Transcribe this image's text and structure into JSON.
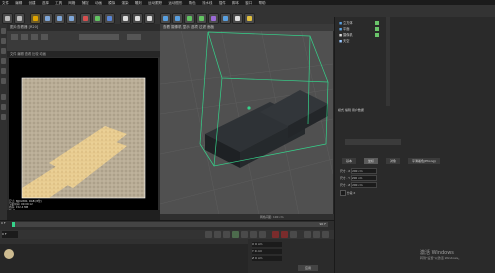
{
  "menubar": {
    "items": [
      "文件",
      "编辑",
      "创建",
      "选择",
      "工具",
      "网格",
      "捕捉",
      "动画",
      "模拟",
      "渲染",
      "雕刻",
      "运动跟踪",
      "运动图形",
      "角色",
      "流水线",
      "插件",
      "脚本",
      "窗口",
      "帮助"
    ]
  },
  "render_view": {
    "title": "图片查看器 [R20]",
    "menu": "文件  编辑  查看  比较  动画",
    "info_lines": [
      "尺寸: 800x800, RGB (8位)",
      "渲染时间: 00:00:12",
      "内存: 152.4 MB",
      "帧: 0"
    ],
    "status": "00:00:12 (1)"
  },
  "viewport": {
    "menu": "查看  摄像机  显示  选项  过滤  面板",
    "bottom": "网格间距: 100 cm"
  },
  "object_manager": {
    "rows": [
      "立方体",
      "平面",
      "摄像机",
      "天空"
    ]
  },
  "attribute_manager": {
    "header": "模式  编辑  用户数据",
    "tabs": [
      "基本",
      "坐标",
      "对象",
      "平滑着色(Phong)"
    ],
    "fields": [
      {
        "label": "尺寸 . X",
        "value": "200 cm"
      },
      {
        "label": "尺寸 . Y",
        "value": "200 cm"
      },
      {
        "label": "尺寸 . Z",
        "value": "200 cm"
      }
    ],
    "checkbox_label": "分段 X"
  },
  "timeline": {
    "start": "0 F",
    "end": "90 F",
    "current": "0 F"
  },
  "coordinates": {
    "rows": [
      "X 0 cm",
      "Y 0 cm",
      "Z 0 cm"
    ],
    "apply": "应用"
  },
  "watermark": {
    "line1": "激活 Windows",
    "line2": "转到\"设置\"以激活 Windows。"
  },
  "colors": {
    "toolbar_accent": "#e0a400",
    "selection_green": "#35d28a",
    "viewport_bg": "#4f4f4f"
  }
}
